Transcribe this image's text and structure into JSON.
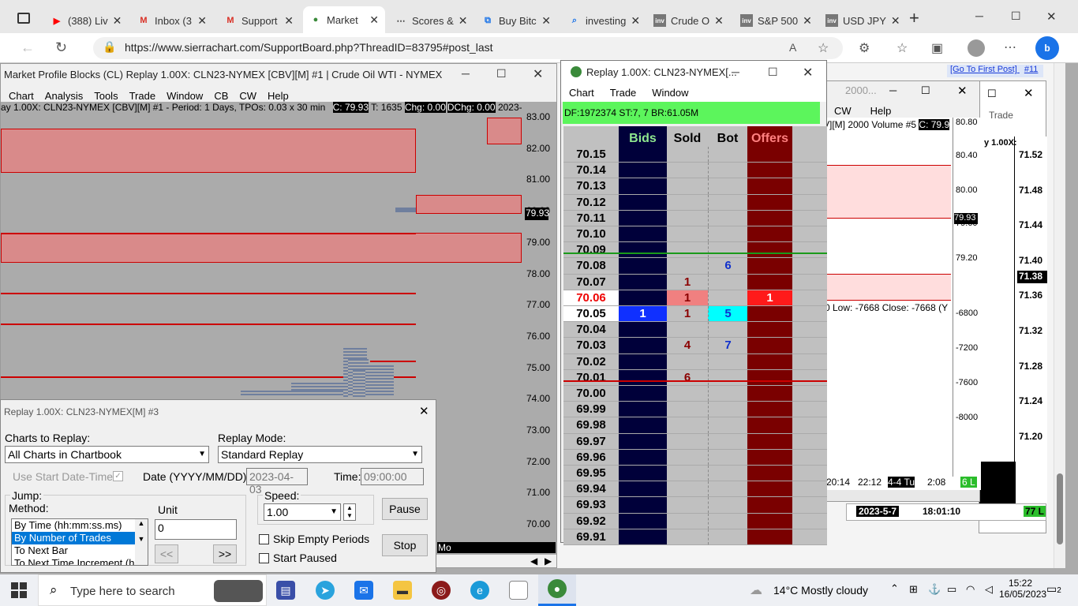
{
  "browser": {
    "tabs": [
      {
        "label": "(388) Liv",
        "icon": "youtube-icon",
        "color": "#ff0000"
      },
      {
        "label": "Inbox (3",
        "icon": "gmail-icon",
        "color": "#d93025"
      },
      {
        "label": "Support",
        "icon": "gmail-icon",
        "color": "#d93025"
      },
      {
        "label": "Market",
        "icon": "globe-icon",
        "color": "#3a8a3a"
      },
      {
        "label": "Scores &",
        "icon": "dots-icon",
        "color": "#444"
      },
      {
        "label": "Buy Bitc",
        "icon": "bitcoin-icon",
        "color": "#1a73e8"
      },
      {
        "label": "investing",
        "icon": "search-icon",
        "color": "#1a73e8"
      },
      {
        "label": "Crude O",
        "icon": "investing-icon",
        "color": "#777"
      },
      {
        "label": "S&P 500",
        "icon": "investing-icon",
        "color": "#777"
      },
      {
        "label": "USD JPY",
        "icon": "investing-icon",
        "color": "#777"
      }
    ],
    "new_tab": "+",
    "url": "https://www.sierrachart.com/SupportBoard.php?ThreadID=83795#post_last",
    "window_min": "─",
    "window_max": "☐",
    "window_close": "✕"
  },
  "forum_links": {
    "first_post": "[Go To First Post]",
    "post_num": "#11"
  },
  "market_profile": {
    "title": "Market Profile Blocks (CL) Replay 1.00X: CLN23-NYMEX [CBV][M]  #1 | Crude Oil WTI - NYMEX (Jul23) (Re...",
    "menu": [
      "Chart",
      "Analysis",
      "Tools",
      "Trade",
      "Window",
      "CB",
      "CW",
      "Help"
    ],
    "info": "ay 1.00X: CLN23-NYMEX [CBV][M]  #1 - Period: 1 Days, TPOs: 0.03 x 30 min",
    "c_label": "C: 79.93",
    "t_label": "T: 1635",
    "chg_label": "Chg: 0.00",
    "dchg_label": "DChg: 0.00",
    "date": "2023-04-03 0",
    "y_labels": [
      "83.00",
      "82.00",
      "81.00",
      "80.00",
      "79.00",
      "78.00",
      "77.00",
      "76.00",
      "75.00",
      "74.00",
      "73.00",
      "72.00",
      "71.00",
      "70.00"
    ],
    "last_price": "79.93",
    "bottom_badge": "4 L",
    "bottom_text": "Mo"
  },
  "replay_dialog": {
    "title": "Replay 1.00X: CLN23-NYMEX[M]  #3",
    "charts_label": "Charts to Replay:",
    "charts_value": "All Charts in Chartbook",
    "mode_label": "Replay Mode:",
    "mode_value": "Standard Replay",
    "use_start_label": "Use Start Date-Time",
    "date_label": "Date (YYYY/MM/DD):",
    "date_value": "2023-04-03",
    "time_label": "Time:",
    "time_value": "09:00:00",
    "jump_label": "Jump:",
    "method_label": "Method:",
    "methods": [
      "By Time (hh:mm:ss.ms)",
      "By Number of Trades",
      "To Next Bar",
      "To Next Time Increment (h"
    ],
    "unit_label": "Unit",
    "unit_value": "0",
    "prev_btn": "<<",
    "next_btn": ">>",
    "speed_label": "Speed:",
    "speed_value": "1.00",
    "skip_label": "Skip Empty Periods",
    "start_paused_label": "Start Paused",
    "pause_btn": "Pause",
    "stop_btn": "Stop"
  },
  "dom": {
    "title": "Replay 1.00X: CLN23-NYMEX[...",
    "menu": [
      "Chart",
      "Trade",
      "Window"
    ],
    "status": "DF:1972374  ST:7, 7   BR:61.05M",
    "headers": {
      "bids": "Bids",
      "sold": "Sold",
      "bot": "Bot",
      "offers": "Offers"
    },
    "colors": {
      "bids": "#00003a",
      "offers": "#7a0000",
      "status": "#5cf55c",
      "header_bids": "#8fe88f",
      "header_offers": "#ff8080"
    },
    "rows": [
      {
        "price": "70.15",
        "bid": "",
        "sold": "",
        "bot": "",
        "offer": ""
      },
      {
        "price": "70.14",
        "bid": "",
        "sold": "",
        "bot": "",
        "offer": ""
      },
      {
        "price": "70.13",
        "bid": "",
        "sold": "",
        "bot": "",
        "offer": ""
      },
      {
        "price": "70.12",
        "bid": "",
        "sold": "",
        "bot": "",
        "offer": ""
      },
      {
        "price": "70.11",
        "bid": "",
        "sold": "",
        "bot": "",
        "offer": ""
      },
      {
        "price": "70.10",
        "bid": "",
        "sold": "",
        "bot": "",
        "offer": ""
      },
      {
        "price": "70.09",
        "bid": "",
        "sold": "",
        "bot": "",
        "offer": ""
      },
      {
        "price": "70.08",
        "bid": "",
        "sold": "",
        "bot": "6",
        "offer": ""
      },
      {
        "price": "70.07",
        "bid": "",
        "sold": "1",
        "bot": "",
        "offer": ""
      },
      {
        "price": "70.06",
        "bid": "",
        "sold": "1",
        "bot": "",
        "offer": "1"
      },
      {
        "price": "70.05",
        "bid": "1",
        "sold": "1",
        "bot": "5",
        "offer": ""
      },
      {
        "price": "70.04",
        "bid": "",
        "sold": "",
        "bot": "",
        "offer": ""
      },
      {
        "price": "70.03",
        "bid": "",
        "sold": "4",
        "bot": "7",
        "offer": ""
      },
      {
        "price": "70.02",
        "bid": "",
        "sold": "",
        "bot": "",
        "offer": ""
      },
      {
        "price": "70.01",
        "bid": "",
        "sold": "6",
        "bot": "",
        "offer": ""
      },
      {
        "price": "70.00",
        "bid": "",
        "sold": "",
        "bot": "",
        "offer": ""
      },
      {
        "price": "69.99",
        "bid": "",
        "sold": "",
        "bot": "",
        "offer": ""
      },
      {
        "price": "69.98",
        "bid": "",
        "sold": "",
        "bot": "",
        "offer": ""
      },
      {
        "price": "69.97",
        "bid": "",
        "sold": "",
        "bot": "",
        "offer": ""
      },
      {
        "price": "69.96",
        "bid": "",
        "sold": "",
        "bot": "",
        "offer": ""
      },
      {
        "price": "69.95",
        "bid": "",
        "sold": "",
        "bot": "",
        "offer": ""
      },
      {
        "price": "69.94",
        "bid": "",
        "sold": "",
        "bot": "",
        "offer": ""
      },
      {
        "price": "69.93",
        "bid": "",
        "sold": "",
        "bot": "",
        "offer": ""
      },
      {
        "price": "69.92",
        "bid": "",
        "sold": "",
        "bot": "",
        "offer": ""
      },
      {
        "price": "69.91",
        "bid": "",
        "sold": "",
        "bot": "",
        "offer": ""
      }
    ]
  },
  "volume_chart": {
    "title": "2000...",
    "menu": [
      "CW",
      "Help"
    ],
    "info": "V][M]  2000 Volume  #5",
    "c_label": "C: 79.9",
    "y_labels": [
      "80.80",
      "80.40",
      "80.00",
      "79.60",
      "79.20",
      "-6800",
      "-7200",
      "-7600",
      "-8000"
    ],
    "last_price": "79.93",
    "study_text": "0  Low: -7668  Close: -7668  (Y",
    "times": [
      "20:14",
      "22:12",
      "4-4 Tu",
      "2:08"
    ],
    "badge": "6 L"
  },
  "far_chart": {
    "menu_label": "Trade",
    "info": "y 1.00X:",
    "y_labels": [
      "71.52",
      "71.48",
      "71.44",
      "71.40",
      "71.36",
      "71.32",
      "71.28",
      "71.24",
      "71.20"
    ],
    "last_price": "71.38",
    "date": "2023-5-7",
    "time": "18:01:10",
    "badge": "77 L"
  },
  "taskbar": {
    "search_placeholder": "Type here to search",
    "weather": "14°C  Mostly cloudy",
    "time": "15:22",
    "date": "16/05/2023",
    "notifications": "2"
  }
}
